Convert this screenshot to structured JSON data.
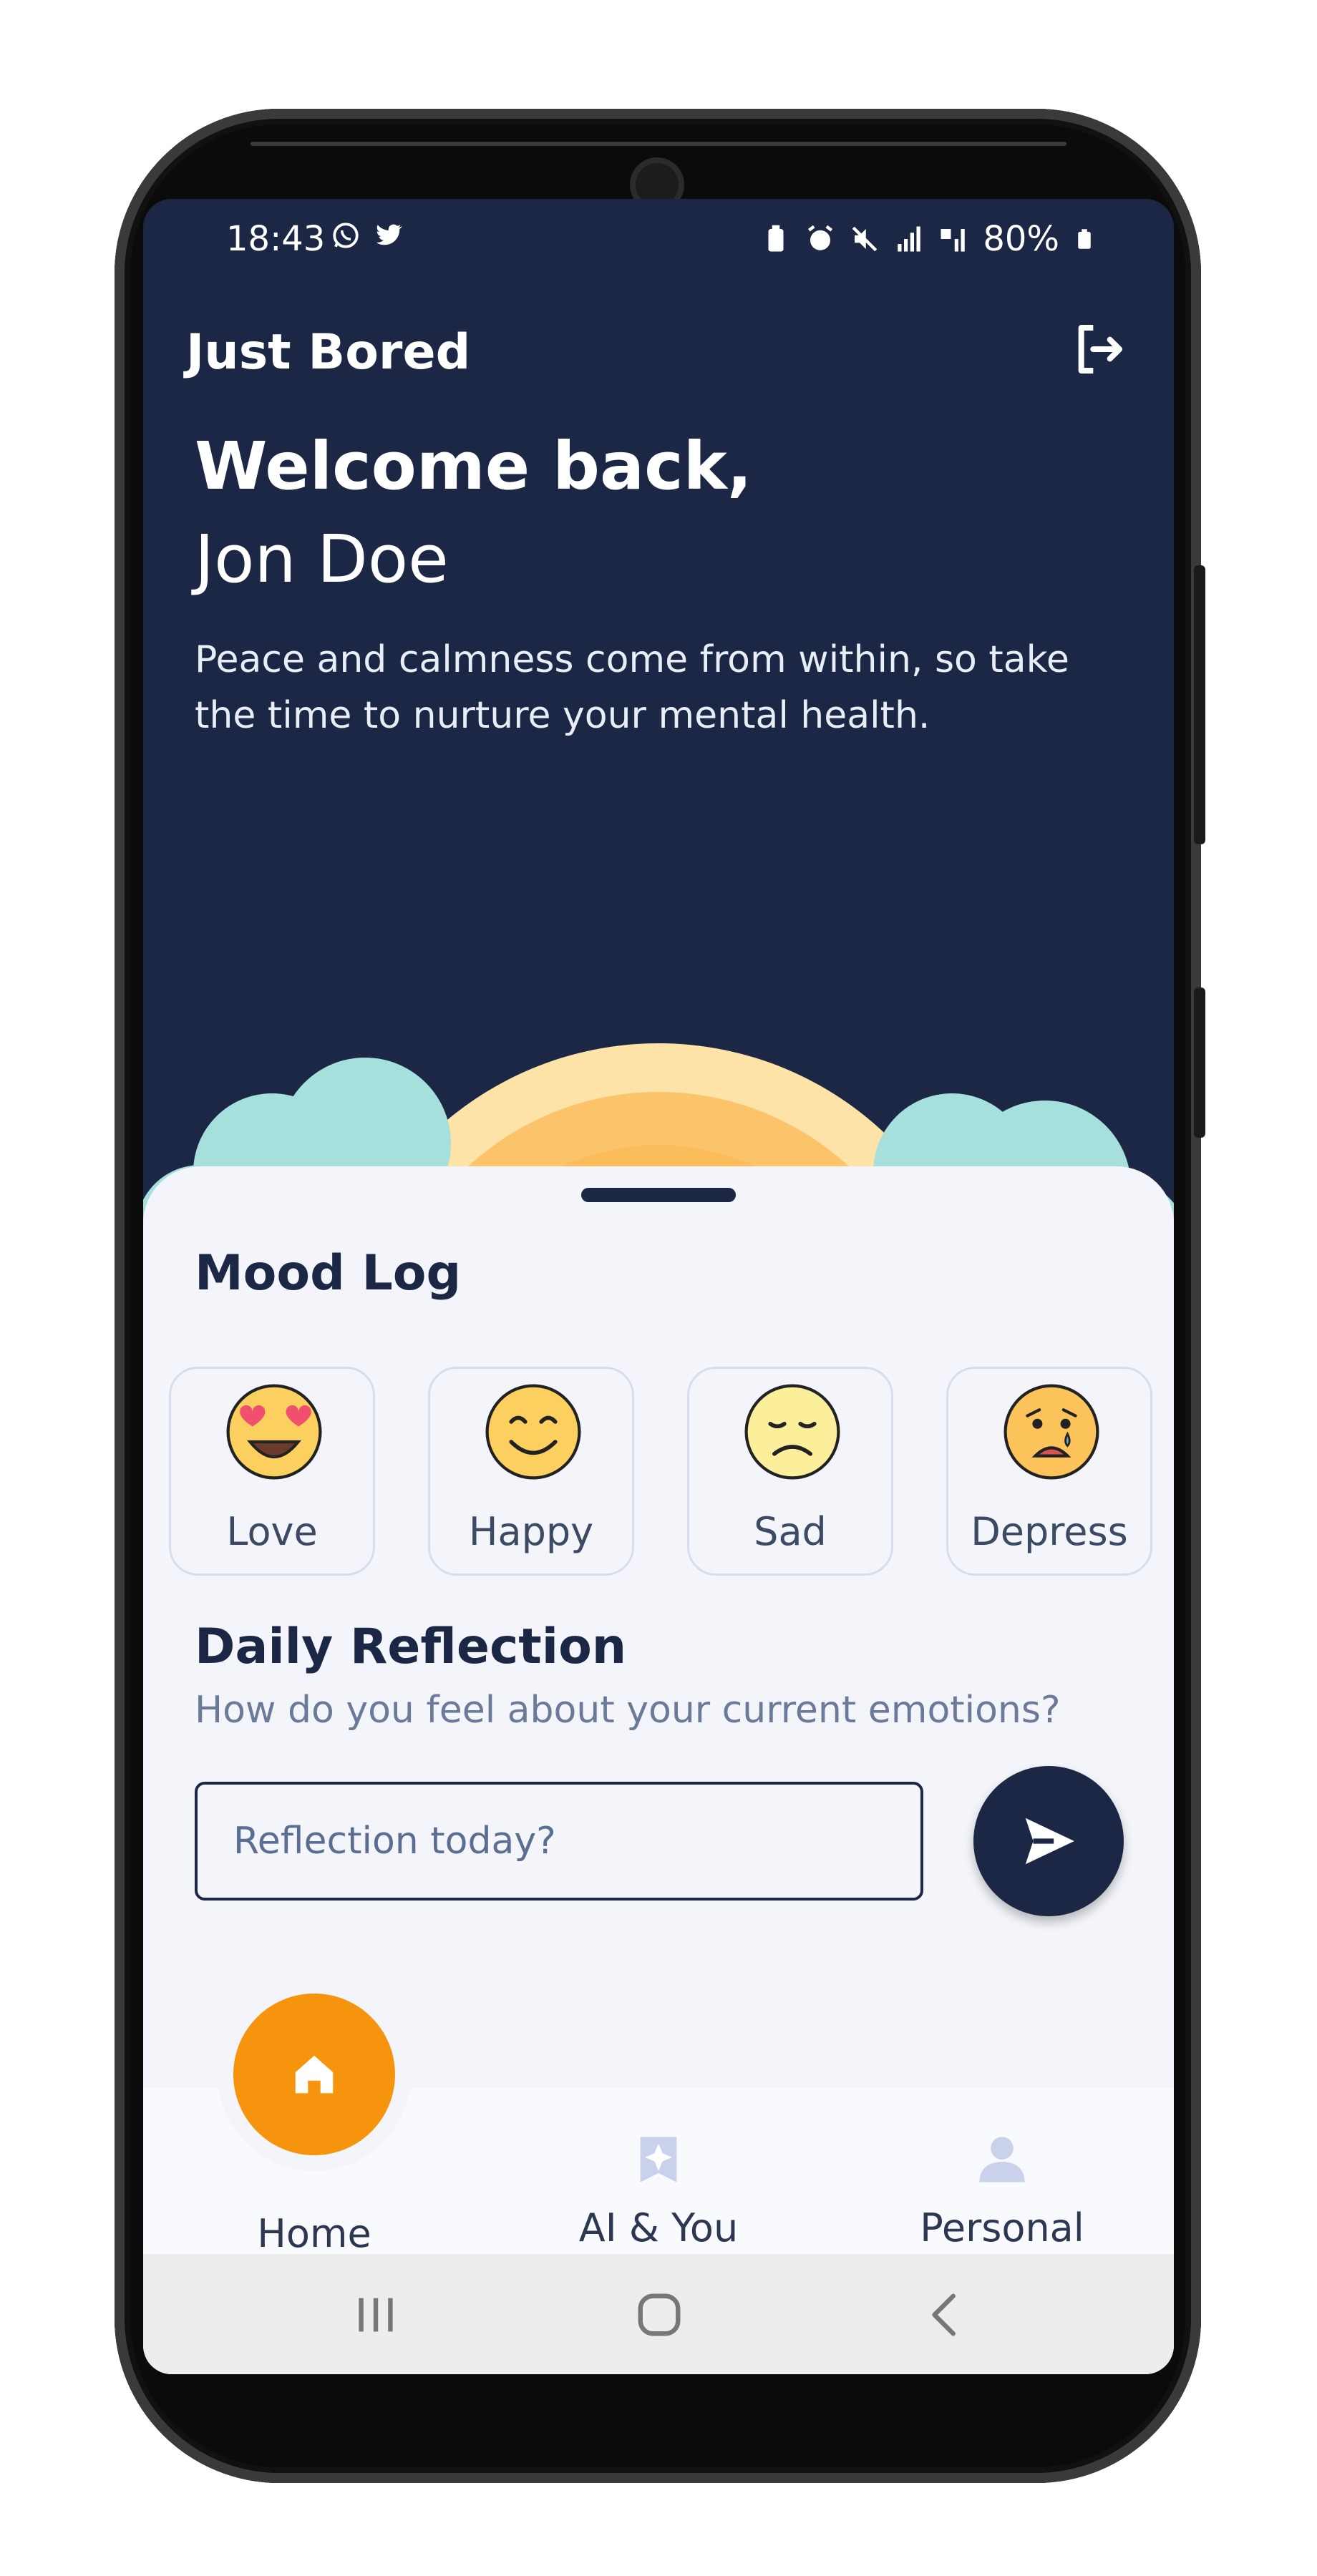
{
  "status_bar": {
    "time": "18:43",
    "battery": "80%",
    "notification_icons": [
      "whatsapp-icon",
      "twitter-icon"
    ],
    "system_icons": [
      "battery-saver-icon",
      "alarm-icon",
      "mute-icon",
      "signal-icon",
      "4g-signal-icon"
    ]
  },
  "app": {
    "title": "Just Bored"
  },
  "header": {
    "welcome": "Welcome back,",
    "user_name": "Jon Doe",
    "tagline": "Peace and calmness come from within, so take the time to nurture your mental health."
  },
  "mood_log": {
    "title": "Mood Log",
    "moods": [
      {
        "label": "Love",
        "icon": "heart-eyes-emoji-icon"
      },
      {
        "label": "Happy",
        "icon": "smiling-emoji-icon"
      },
      {
        "label": "Sad",
        "icon": "sad-emoji-icon"
      },
      {
        "label": "Depress",
        "icon": "crying-emoji-icon"
      }
    ]
  },
  "reflection": {
    "title": "Daily Reflection",
    "subtitle": "How do you feel about your current emotions?",
    "placeholder": "Reflection today?",
    "send_icon": "send-icon"
  },
  "nav": {
    "items": [
      {
        "label": "Home",
        "icon": "home-icon"
      },
      {
        "label": "AI & You",
        "icon": "ai-sparkle-icon"
      },
      {
        "label": "Personal",
        "icon": "person-icon"
      }
    ],
    "active": "Home"
  },
  "colors": {
    "header_bg": "#1b2744",
    "sheet_bg": "#f3f5fa",
    "accent": "#f7940e"
  }
}
